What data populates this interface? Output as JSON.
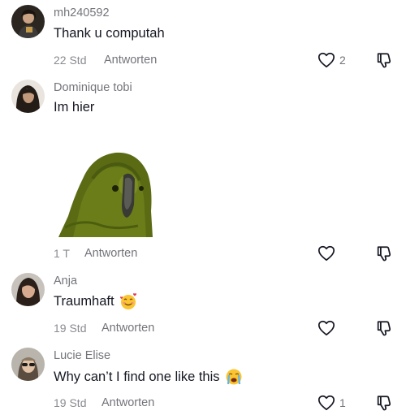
{
  "comments": [
    {
      "username": "mh240592",
      "text": "Thank u computah",
      "time": "22 Std",
      "reply_label": "Antworten",
      "like_count": "2"
    },
    {
      "username": "Dominique tobi",
      "text": "Im hier",
      "time": "1 T",
      "reply_label": "Antworten",
      "like_count": "",
      "sticker": "parrot-sticker"
    },
    {
      "username": "Anja",
      "text": "Traumhaft",
      "emoji": "smiling-face-with-hearts",
      "time": "19 Std",
      "reply_label": "Antworten",
      "like_count": ""
    },
    {
      "username": "Lucie Elise",
      "text": "Why can’t I find one like this",
      "emoji": "loudly-crying-face",
      "time": "19 Std",
      "reply_label": "Antworten",
      "like_count": "1"
    }
  ],
  "icons": {
    "like": "heart-outline-icon",
    "dislike": "thumbs-down-outline-icon"
  },
  "colors": {
    "text": "#161823",
    "secondary": "#73747b",
    "icon": "#161823",
    "background": "#ffffff"
  }
}
